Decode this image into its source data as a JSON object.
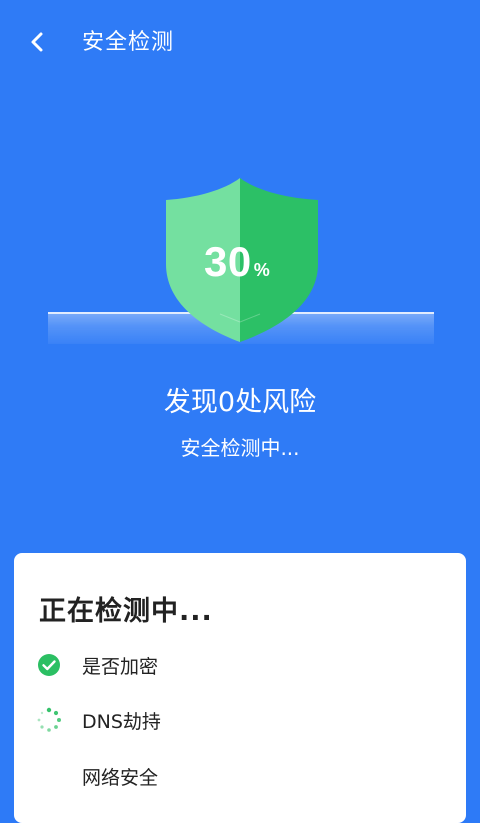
{
  "header": {
    "title": "安全检测",
    "back_icon": "chevron-left-icon"
  },
  "shield": {
    "percent": "30",
    "unit": "%",
    "progress": 0.3,
    "colors": {
      "left": "#6bdb97",
      "right": "#2bbf63"
    }
  },
  "status": {
    "risk": "发现0处风险",
    "scanning": "安全检测中..."
  },
  "card": {
    "title": "正在检测中...",
    "items": [
      {
        "label": "是否加密",
        "state": "done",
        "icon": "check-circle-icon"
      },
      {
        "label": "DNS劫持",
        "state": "loading",
        "icon": "spinner-icon"
      },
      {
        "label": "网络安全",
        "state": "pending",
        "icon": ""
      }
    ]
  },
  "colors": {
    "background": "#2f7bf6",
    "success": "#2bbf63",
    "card": "#ffffff"
  }
}
